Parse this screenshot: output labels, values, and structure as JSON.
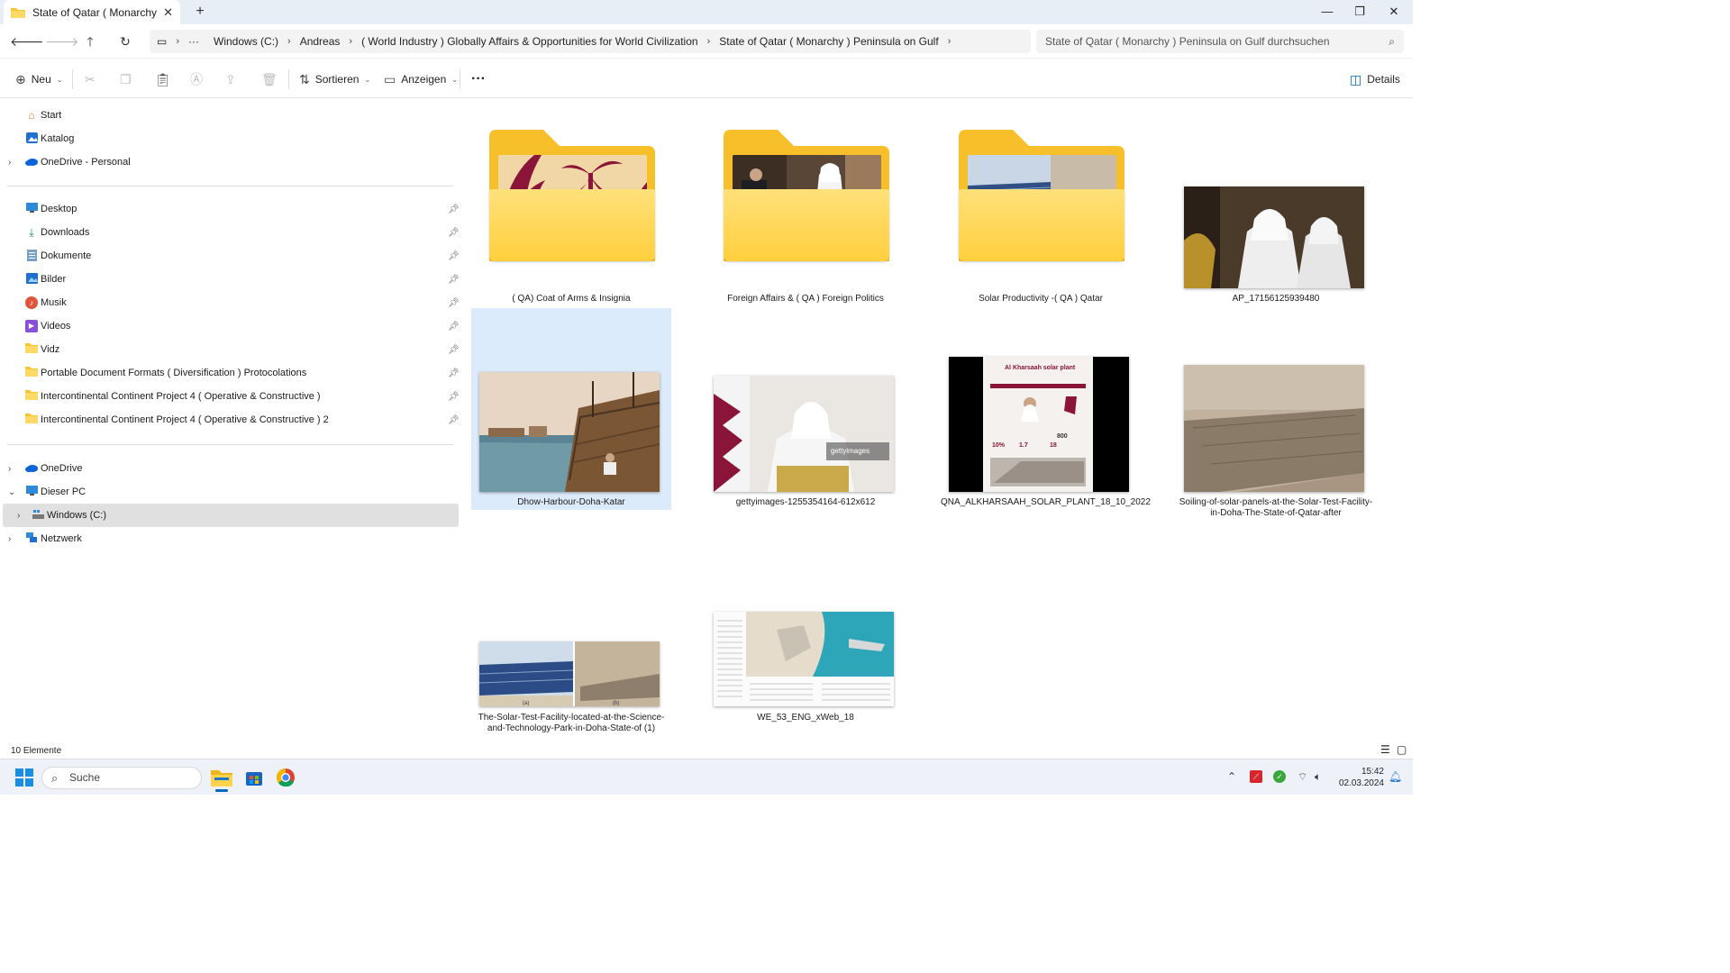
{
  "window": {
    "tab_title": "State of Qatar ( Monarchy ) Pe",
    "minimize": "—",
    "maximize": "❐",
    "close": "✕"
  },
  "address": {
    "overflow": "···",
    "breadcrumbs": [
      "Windows (C:)",
      "Andreas",
      "( World Industry ) Globally Affairs & Opportunities for World Civilization",
      "State of Qatar ( Monarchy )  Peninsula on Gulf"
    ],
    "search_placeholder": "State of Qatar ( Monarchy )  Peninsula on Gulf durchsuchen"
  },
  "commandbar": {
    "new_label": "Neu",
    "sort_label": "Sortieren",
    "view_label": "Anzeigen",
    "more_label": "···",
    "details_label": "Details"
  },
  "sidebar": {
    "top": [
      {
        "label": "Start",
        "icon": "home-icon"
      },
      {
        "label": "Katalog",
        "icon": "gallery-icon"
      },
      {
        "label": "OneDrive - Personal",
        "icon": "cloud-icon"
      }
    ],
    "pinned": [
      {
        "label": "Desktop",
        "icon": "desktop-icon"
      },
      {
        "label": "Downloads",
        "icon": "download-icon"
      },
      {
        "label": "Dokumente",
        "icon": "document-icon"
      },
      {
        "label": "Bilder",
        "icon": "pictures-icon"
      },
      {
        "label": "Musik",
        "icon": "music-icon"
      },
      {
        "label": "Videos",
        "icon": "video-icon"
      },
      {
        "label": "Vidz",
        "icon": "folder-icon"
      },
      {
        "label": "Portable Document Formats ( Diversification ) Protocolations",
        "icon": "folder-icon"
      },
      {
        "label": "Intercontinental Continent Project 4 ( Operative & Constructive )",
        "icon": "folder-icon"
      },
      {
        "label": "Intercontinental Continent Project 4 ( Operative & Constructive ) 2",
        "icon": "folder-icon"
      }
    ],
    "bottom": [
      {
        "label": "OneDrive",
        "icon": "cloud-icon"
      },
      {
        "label": "Dieser PC",
        "icon": "pc-icon"
      },
      {
        "label": "Windows (C:)",
        "icon": "drive-icon"
      },
      {
        "label": "Netzwerk",
        "icon": "network-icon"
      }
    ]
  },
  "items": [
    {
      "name": "( QA) Coat of Arms & Insignia",
      "type": "folder"
    },
    {
      "name": "Foreign Affairs & ( QA ) Foreign Politics",
      "type": "folder"
    },
    {
      "name": "Solar Productivity -( QA ) Qatar",
      "type": "folder"
    },
    {
      "name": "AP_17156125939480",
      "type": "image"
    },
    {
      "name": "Dhow-Harbour-Doha-Katar",
      "type": "image",
      "selected": true
    },
    {
      "name": "gettyimages-1255354164-612x612",
      "type": "image"
    },
    {
      "name": "QNA_ALKHARSAAH_SOLAR_PLANT_18_10_2022",
      "type": "image"
    },
    {
      "name": "Soiling-of-solar-panels-at-the-Solar-Test-Facility-in-Doha-The-State-of-Qatar-after",
      "type": "image"
    },
    {
      "name": "The-Solar-Test-Facility-located-at-the-Science-and-Technology-Park-in-Doha-State-of (1)",
      "type": "image"
    },
    {
      "name": "WE_53_ENG_xWeb_18",
      "type": "image"
    }
  ],
  "thumb_text": {
    "getty_watermark": "gettyimages",
    "infographic_title": "Al Kharsaah solar plant",
    "stat1": "10%",
    "stat2": "1.7",
    "stat3": "18",
    "stat4": "800",
    "solar_a": "(a)",
    "solar_b": "(b)"
  },
  "status": {
    "count": "10 Elemente"
  },
  "taskbar": {
    "search_label": "Suche",
    "time": "15:42",
    "date": "02.03.2024"
  },
  "colors": {
    "accent": "#0067c0",
    "folder": "#ffcf3d",
    "maroon": "#8a1538"
  }
}
